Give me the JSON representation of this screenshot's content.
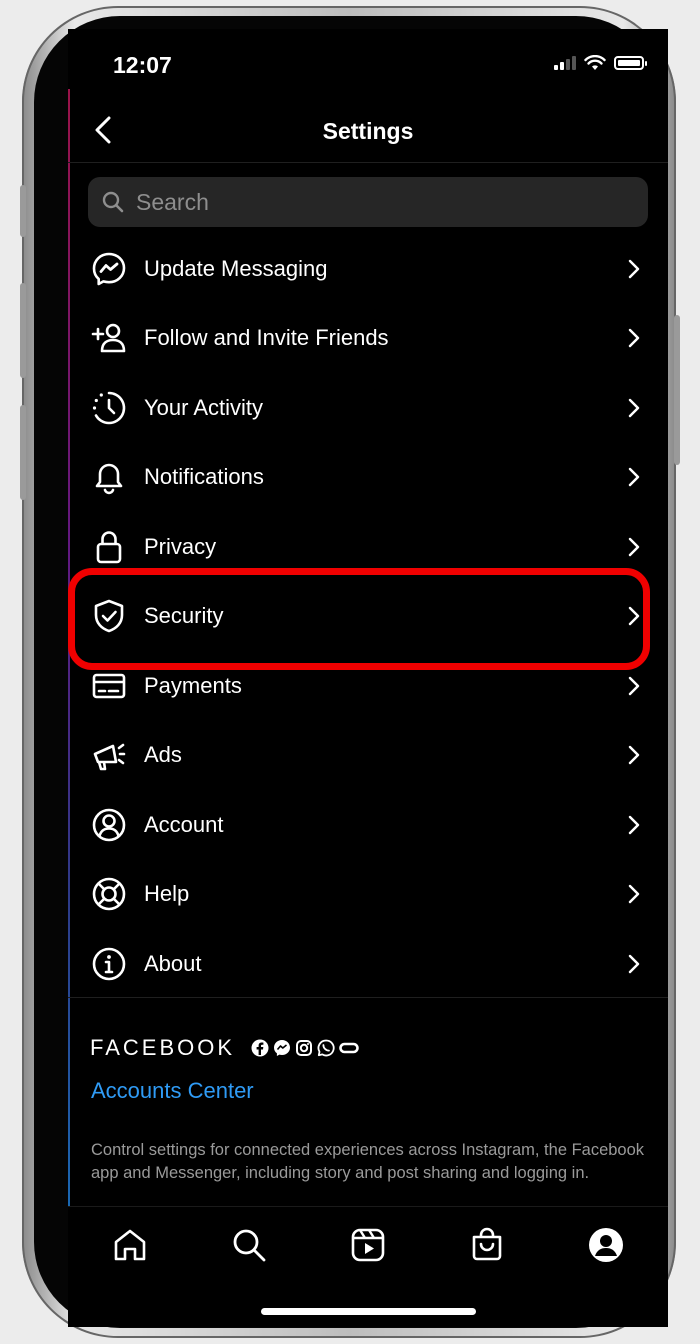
{
  "status_bar": {
    "time": "12:07"
  },
  "header": {
    "title": "Settings"
  },
  "search": {
    "placeholder": "Search"
  },
  "menu_items": [
    {
      "label": "Update Messaging",
      "icon": "messenger-icon"
    },
    {
      "label": "Follow and Invite Friends",
      "icon": "add-person-icon"
    },
    {
      "label": "Your Activity",
      "icon": "activity-clock-icon"
    },
    {
      "label": "Notifications",
      "icon": "bell-icon"
    },
    {
      "label": "Privacy",
      "icon": "lock-icon"
    },
    {
      "label": "Security",
      "icon": "shield-icon"
    },
    {
      "label": "Payments",
      "icon": "card-icon"
    },
    {
      "label": "Ads",
      "icon": "megaphone-icon"
    },
    {
      "label": "Account",
      "icon": "user-circle-icon"
    },
    {
      "label": "Help",
      "icon": "lifebuoy-icon"
    },
    {
      "label": "About",
      "icon": "info-icon"
    }
  ],
  "facebook_section": {
    "brand": "FACEBOOK",
    "accounts_center": "Accounts Center",
    "description": "Control settings for connected experiences across Instagram, the Facebook app and Messenger, including story and post sharing and logging in."
  },
  "highlighted_item": "Security",
  "colors": {
    "background": "#000000",
    "highlight_border": "#f00000",
    "link": "#2f9bf5",
    "search_field": "#262626"
  },
  "tab_bar": [
    "home-icon",
    "search-icon",
    "reels-icon",
    "shop-icon",
    "profile-icon"
  ]
}
